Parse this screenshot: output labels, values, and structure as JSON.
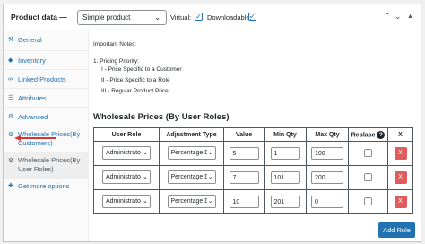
{
  "header": {
    "label": "Product data —",
    "product_type": "Simple product",
    "virtual_label": "Virtual:",
    "downloadable_label": "Downloadable:"
  },
  "sidebar": {
    "items": [
      {
        "label": "General",
        "icon": "wrench-icon"
      },
      {
        "label": "Inventory",
        "icon": "tag-icon"
      },
      {
        "label": "Linked Products",
        "icon": "link-icon"
      },
      {
        "label": "Attributes",
        "icon": "list-icon"
      },
      {
        "label": "Advanced",
        "icon": "gear-icon"
      },
      {
        "label_line1": "Wholesale Prices(By",
        "label_line2": "Customers)",
        "icon": "gear-icon"
      },
      {
        "label_line1": "Wholesale Prices(By",
        "label_line2": "User Roles)",
        "icon": "gear-icon"
      },
      {
        "label": "Get more options",
        "icon": "plugin-icon"
      }
    ]
  },
  "notes": {
    "title": "Important Notes:",
    "priority_title": "1. Pricing Priority:",
    "lines": [
      "I - Price Specific to a Customer",
      "II - Price Specific to a Role",
      "III - Regular Product Price"
    ]
  },
  "section_title": "Wholesale Prices (By User Roles)",
  "table": {
    "headers": [
      "User Role",
      "Adjustment Type",
      "Value",
      "Min Qty",
      "Max Qty",
      "Replace",
      "X"
    ],
    "rows": [
      {
        "role": "Administrato",
        "adjustment": "Percentage D",
        "value": "5",
        "min": "1",
        "max": "100",
        "delete": "X"
      },
      {
        "role": "Administrato",
        "adjustment": "Percentage D",
        "value": "7",
        "min": "101",
        "max": "200",
        "delete": "X"
      },
      {
        "role": "Administrato",
        "adjustment": "Percentage D",
        "value": "10",
        "min": "201",
        "max": "0",
        "delete": "X"
      }
    ]
  },
  "add_rule_label": "Add Rule",
  "colors": {
    "accent": "#2271b1",
    "delete": "#e05b5b",
    "arrow": "#d63638"
  }
}
